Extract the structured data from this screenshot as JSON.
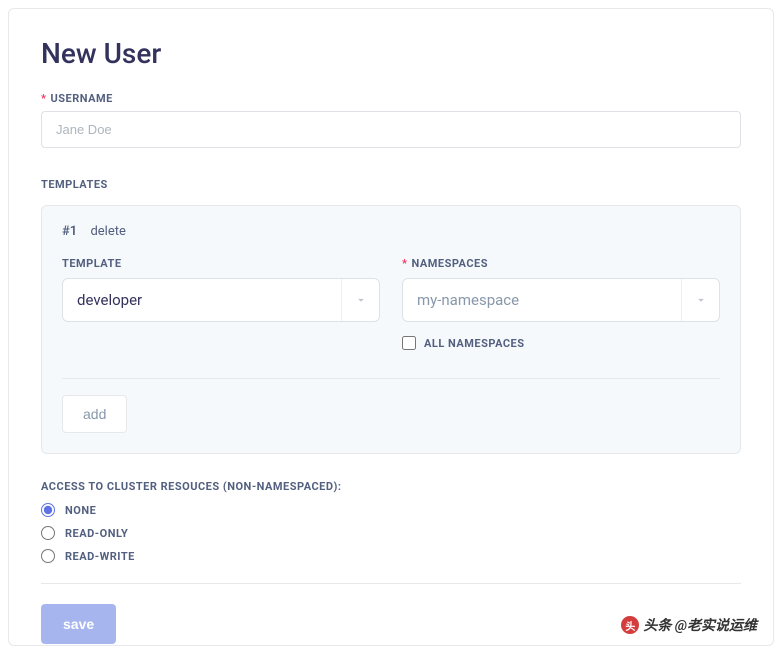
{
  "title": "New User",
  "username": {
    "label": "USERNAME",
    "placeholder": "Jane Doe",
    "value": ""
  },
  "templates_heading": "TEMPLATES",
  "template_item": {
    "index_label": "#1",
    "delete_label": "delete",
    "template_label": "TEMPLATE",
    "template_value": "developer",
    "namespaces_label": "NAMESPACES",
    "namespaces_placeholder": "my-namespace",
    "all_namespaces_label": "ALL NAMESPACES",
    "all_namespaces_checked": false
  },
  "add_label": "add",
  "access": {
    "heading": "ACCESS TO CLUSTER RESOUCES (NON-NAMESPACED):",
    "options": [
      {
        "label": "NONE",
        "checked": true
      },
      {
        "label": "READ-ONLY",
        "checked": false
      },
      {
        "label": "READ-WRITE",
        "checked": false
      }
    ]
  },
  "save_label": "save",
  "watermark": "头条 @老实说运维"
}
